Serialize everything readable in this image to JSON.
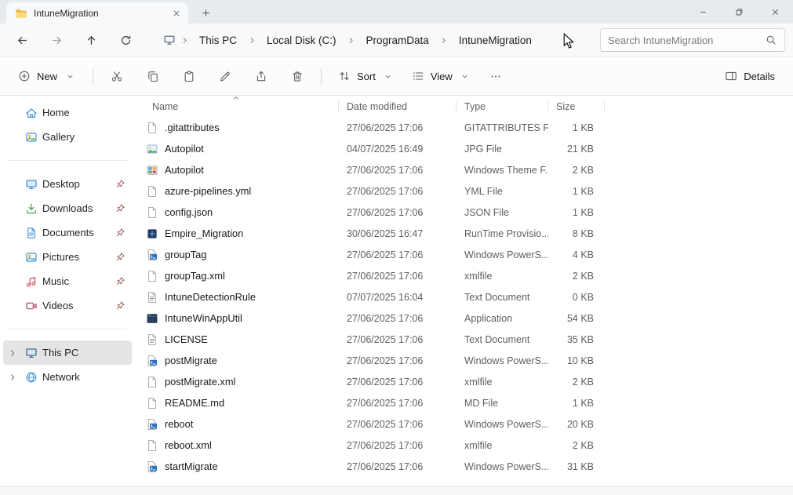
{
  "window": {
    "tab_title": "IntuneMigration"
  },
  "nav": {
    "breadcrumb": [
      "This PC",
      "Local Disk (C:)",
      "ProgramData",
      "IntuneMigration"
    ],
    "search_placeholder": "Search IntuneMigration"
  },
  "toolbar": {
    "new": "New",
    "sort": "Sort",
    "view": "View",
    "details": "Details"
  },
  "sidebar": {
    "groups": [
      {
        "items": [
          {
            "label": "Home",
            "icon": "home-icon"
          },
          {
            "label": "Gallery",
            "icon": "gallery-icon"
          }
        ]
      },
      {
        "items": [
          {
            "label": "Desktop",
            "icon": "desktop-icon",
            "pinned": true
          },
          {
            "label": "Downloads",
            "icon": "downloads-icon",
            "pinned": true
          },
          {
            "label": "Documents",
            "icon": "documents-icon",
            "pinned": true
          },
          {
            "label": "Pictures",
            "icon": "pictures-icon",
            "pinned": true
          },
          {
            "label": "Music",
            "icon": "music-icon",
            "pinned": true
          },
          {
            "label": "Videos",
            "icon": "videos-icon",
            "pinned": true
          }
        ]
      },
      {
        "items": [
          {
            "label": "This PC",
            "icon": "this-pc-icon",
            "expander": true,
            "selected": true
          },
          {
            "label": "Network",
            "icon": "network-icon",
            "expander": true
          }
        ]
      }
    ]
  },
  "filelist": {
    "columns": [
      "Name",
      "Date modified",
      "Type",
      "Size"
    ],
    "sorted_by": "Name",
    "rows": [
      {
        "name": ".gitattributes",
        "icon": "file-generic-icon",
        "date_modified": "27/06/2025 17:06",
        "type": "GITATTRIBUTES File",
        "size": "1 KB"
      },
      {
        "name": "Autopilot",
        "icon": "file-image-icon",
        "date_modified": "04/07/2025 16:49",
        "type": "JPG File",
        "size": "21 KB"
      },
      {
        "name": "Autopilot",
        "icon": "file-theme-icon",
        "date_modified": "27/06/2025 17:06",
        "type": "Windows Theme F...",
        "size": "2 KB"
      },
      {
        "name": "azure-pipelines.yml",
        "icon": "file-generic-icon",
        "date_modified": "27/06/2025 17:06",
        "type": "YML File",
        "size": "1 KB"
      },
      {
        "name": "config.json",
        "icon": "file-generic-icon",
        "date_modified": "27/06/2025 17:06",
        "type": "JSON File",
        "size": "1 KB"
      },
      {
        "name": "Empire_Migration",
        "icon": "file-runtime-icon",
        "date_modified": "30/06/2025 16:47",
        "type": "RunTime Provisio...",
        "size": "8 KB"
      },
      {
        "name": "groupTag",
        "icon": "file-ps-icon",
        "date_modified": "27/06/2025 17:06",
        "type": "Windows PowerS...",
        "size": "4 KB"
      },
      {
        "name": "groupTag.xml",
        "icon": "file-generic-icon",
        "date_modified": "27/06/2025 17:06",
        "type": "xmlfile",
        "size": "2 KB"
      },
      {
        "name": "IntuneDetectionRule",
        "icon": "file-text-icon",
        "date_modified": "07/07/2025 16:04",
        "type": "Text Document",
        "size": "0 KB"
      },
      {
        "name": "IntuneWinAppUtil",
        "icon": "file-app-icon",
        "date_modified": "27/06/2025 17:06",
        "type": "Application",
        "size": "54 KB"
      },
      {
        "name": "LICENSE",
        "icon": "file-text-icon",
        "date_modified": "27/06/2025 17:06",
        "type": "Text Document",
        "size": "35 KB"
      },
      {
        "name": "postMigrate",
        "icon": "file-ps-icon",
        "date_modified": "27/06/2025 17:06",
        "type": "Windows PowerS...",
        "size": "10 KB"
      },
      {
        "name": "postMigrate.xml",
        "icon": "file-generic-icon",
        "date_modified": "27/06/2025 17:06",
        "type": "xmlfile",
        "size": "2 KB"
      },
      {
        "name": "README.md",
        "icon": "file-generic-icon",
        "date_modified": "27/06/2025 17:06",
        "type": "MD File",
        "size": "1 KB"
      },
      {
        "name": "reboot",
        "icon": "file-ps-icon",
        "date_modified": "27/06/2025 17:06",
        "type": "Windows PowerS...",
        "size": "20 KB"
      },
      {
        "name": "reboot.xml",
        "icon": "file-generic-icon",
        "date_modified": "27/06/2025 17:06",
        "type": "xmlfile",
        "size": "2 KB"
      },
      {
        "name": "startMigrate",
        "icon": "file-ps-icon",
        "date_modified": "27/06/2025 17:06",
        "type": "Windows PowerS...",
        "size": "31 KB"
      }
    ]
  },
  "colors": {
    "accent": "#0067c0",
    "titlebar_bg": "#e8ebee",
    "chrome_bg": "#f7f9fa",
    "selected_bg": "#e4e4e4"
  }
}
